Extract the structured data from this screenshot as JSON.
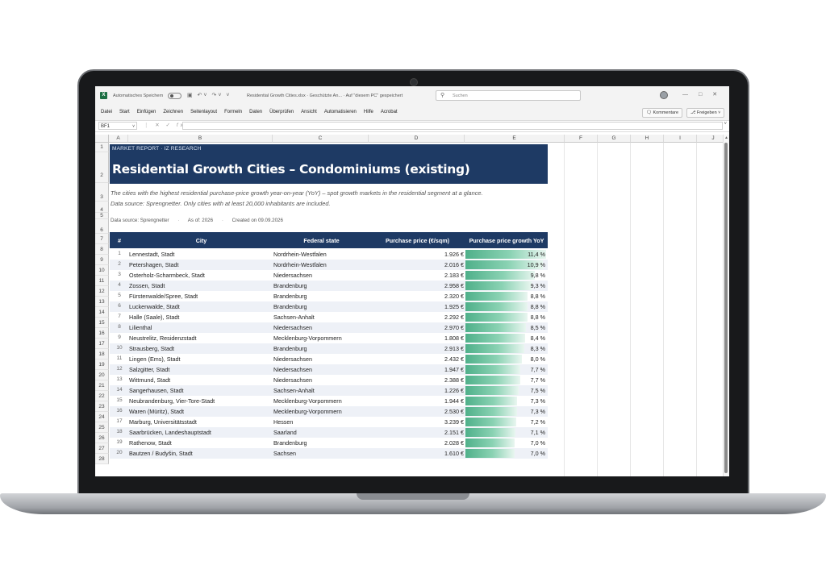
{
  "app": {
    "autosave_label": "Automatisches Speichern",
    "doc_title": "Residential Growth Cities.xlsx  ·  Geschützte An...  ·  Auf \"diesem PC\" gespeichert",
    "search_placeholder": "Suchen",
    "ribbon_tabs": [
      "Datei",
      "Start",
      "Einfügen",
      "Zeichnen",
      "Seitenlayout",
      "Formeln",
      "Daten",
      "Überprüfen",
      "Ansicht",
      "Automatisieren",
      "Hilfe",
      "Acrobat"
    ],
    "comments_label": "Kommentare",
    "share_label": "Freigeben",
    "namebox": "BF1",
    "fx": "fx"
  },
  "grid": {
    "columns": [
      "A",
      "B",
      "C",
      "D",
      "E",
      "F",
      "G",
      "H",
      "I",
      "J"
    ],
    "rows": [
      "1",
      "2",
      "3",
      "4",
      "5",
      "6",
      "7",
      "8",
      "9",
      "10",
      "11",
      "12",
      "13",
      "14",
      "15",
      "16",
      "17",
      "18",
      "19",
      "20",
      "21",
      "22",
      "23",
      "24",
      "25",
      "26",
      "27",
      "28"
    ]
  },
  "report": {
    "kicker": "MARKET REPORT · IZ RESEARCH",
    "title": "Residential Growth Cities – Condominiums (existing)",
    "subtitle_line1": "The cities with the highest residential purchase-price growth year-on-year (YoY) – spot growth markets in the residential segment at a glance.",
    "subtitle_line2": "Data source: Sprengnetter. Only cities with at least 20,000 inhabitants are included.",
    "meta": {
      "source": "Data source: Sprengnetter",
      "as_of": "As of: 2026",
      "created": "Created on 09.09.2026",
      "separator": "·"
    },
    "table_headers": {
      "rank": "#",
      "city": "City",
      "state": "Federal state",
      "price": "Purchase price (€/sqm)",
      "growth": "Purchase price growth YoY"
    },
    "rows": [
      {
        "rank": "1",
        "city": "Lennestadt, Stadt",
        "state": "Nordrhein-Westfalen",
        "price": "1.926 €",
        "growth": "11,4 %",
        "growth_value": 11.4
      },
      {
        "rank": "2",
        "city": "Petershagen, Stadt",
        "state": "Nordrhein-Westfalen",
        "price": "2.016 €",
        "growth": "10,9 %",
        "growth_value": 10.9
      },
      {
        "rank": "3",
        "city": "Osterholz-Scharmbeck, Stadt",
        "state": "Niedersachsen",
        "price": "2.183 €",
        "growth": "9,8 %",
        "growth_value": 9.8
      },
      {
        "rank": "4",
        "city": "Zossen, Stadt",
        "state": "Brandenburg",
        "price": "2.958 €",
        "growth": "9,3 %",
        "growth_value": 9.3
      },
      {
        "rank": "5",
        "city": "Fürstenwalde/Spree, Stadt",
        "state": "Brandenburg",
        "price": "2.320 €",
        "growth": "8,8 %",
        "growth_value": 8.8
      },
      {
        "rank": "6",
        "city": "Luckenwalde, Stadt",
        "state": "Brandenburg",
        "price": "1.925 €",
        "growth": "8,8 %",
        "growth_value": 8.8
      },
      {
        "rank": "7",
        "city": "Halle (Saale), Stadt",
        "state": "Sachsen-Anhalt",
        "price": "2.292 €",
        "growth": "8,8 %",
        "growth_value": 8.8
      },
      {
        "rank": "8",
        "city": "Lilienthal",
        "state": "Niedersachsen",
        "price": "2.970 €",
        "growth": "8,5 %",
        "growth_value": 8.5
      },
      {
        "rank": "9",
        "city": "Neustrelitz, Residenzstadt",
        "state": "Mecklenburg-Vorpommern",
        "price": "1.808 €",
        "growth": "8,4 %",
        "growth_value": 8.4
      },
      {
        "rank": "10",
        "city": "Strausberg, Stadt",
        "state": "Brandenburg",
        "price": "2.913 €",
        "growth": "8,3 %",
        "growth_value": 8.3
      },
      {
        "rank": "11",
        "city": "Lingen (Ems), Stadt",
        "state": "Niedersachsen",
        "price": "2.432 €",
        "growth": "8,0 %",
        "growth_value": 8.0
      },
      {
        "rank": "12",
        "city": "Salzgitter, Stadt",
        "state": "Niedersachsen",
        "price": "1.947 €",
        "growth": "7,7 %",
        "growth_value": 7.7
      },
      {
        "rank": "13",
        "city": "Wittmund, Stadt",
        "state": "Niedersachsen",
        "price": "2.388 €",
        "growth": "7,7 %",
        "growth_value": 7.7
      },
      {
        "rank": "14",
        "city": "Sangerhausen, Stadt",
        "state": "Sachsen-Anhalt",
        "price": "1.226 €",
        "growth": "7,5 %",
        "growth_value": 7.5
      },
      {
        "rank": "15",
        "city": "Neubrandenburg, Vier-Tore-Stadt",
        "state": "Mecklenburg-Vorpommern",
        "price": "1.944 €",
        "growth": "7,3 %",
        "growth_value": 7.3
      },
      {
        "rank": "16",
        "city": "Waren (Müritz), Stadt",
        "state": "Mecklenburg-Vorpommern",
        "price": "2.530 €",
        "growth": "7,3 %",
        "growth_value": 7.3
      },
      {
        "rank": "17",
        "city": "Marburg, Universitätsstadt",
        "state": "Hessen",
        "price": "3.239 €",
        "growth": "7,2 %",
        "growth_value": 7.2
      },
      {
        "rank": "18",
        "city": "Saarbrücken, Landeshauptstadt",
        "state": "Saarland",
        "price": "2.151 €",
        "growth": "7,1 %",
        "growth_value": 7.1
      },
      {
        "rank": "19",
        "city": "Rathenow, Stadt",
        "state": "Brandenburg",
        "price": "2.028 €",
        "growth": "7,0 %",
        "growth_value": 7.0
      },
      {
        "rank": "20",
        "city": "Bautzen / Budyšin, Stadt",
        "state": "Sachsen",
        "price": "1.610 €",
        "growth": "7,0 %",
        "growth_value": 7.0
      }
    ]
  },
  "colors": {
    "header_band": "#1e3a64",
    "bar_start": "#4fb08a",
    "bar_end": "#e9f6f0",
    "alt_row": "#eef1f7",
    "excel_green": "#1d7044"
  },
  "icons": [
    "excel-logo-icon",
    "save-icon",
    "undo-icon",
    "redo-icon",
    "search-icon",
    "user-avatar-icon",
    "minimize-icon",
    "maximize-icon",
    "close-icon",
    "comment-icon",
    "share-icon"
  ]
}
